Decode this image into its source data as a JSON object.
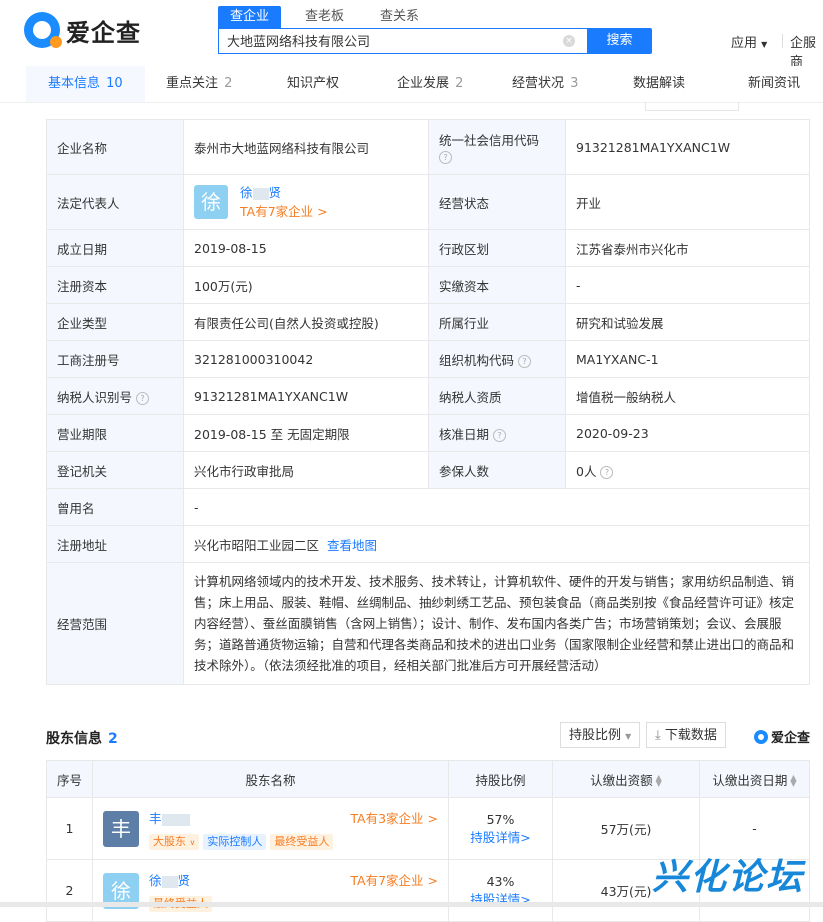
{
  "logo": {
    "text": "爱企查"
  },
  "search": {
    "tabs": [
      "查企业",
      "查老板",
      "查关系"
    ],
    "value": "大地蓝网络科技有限公司",
    "button": "搜索"
  },
  "header_links": {
    "apps": "应用",
    "service": "企服商"
  },
  "tabs": [
    {
      "label": "基本信息",
      "count": "10"
    },
    {
      "label": "重点关注",
      "count": "2"
    },
    {
      "label": "知识产权",
      "count": ""
    },
    {
      "label": "企业发展",
      "count": "2"
    },
    {
      "label": "经营状况",
      "count": "3"
    },
    {
      "label": "数据解读",
      "count": ""
    },
    {
      "label": "新闻资讯",
      "count": ""
    }
  ],
  "info": {
    "company_name_label": "企业名称",
    "company_name": "泰州市大地蓝网络科技有限公司",
    "credit_code_label": "统一社会信用代码",
    "credit_code": "91321281MA1YXANC1W",
    "legal_rep_label": "法定代表人",
    "legal_rep_avatar": "徐",
    "legal_rep_name_a": "徐",
    "legal_rep_name_b": "贤",
    "legal_rep_link": "TA有7家企业 >",
    "status_label": "经营状态",
    "status": "开业",
    "founded_label": "成立日期",
    "founded": "2019-08-15",
    "region_label": "行政区划",
    "region": "江苏省泰州市兴化市",
    "capital_label": "注册资本",
    "capital": "100万(元)",
    "paid_label": "实缴资本",
    "paid": "-",
    "type_label": "企业类型",
    "type": "有限责任公司(自然人投资或控股)",
    "industry_label": "所属行业",
    "industry": "研究和试验发展",
    "reg_no_label": "工商注册号",
    "reg_no": "321281000310042",
    "org_code_label": "组织机构代码",
    "org_code": "MA1YXANC-1",
    "tax_id_label": "纳税人识别号",
    "tax_id": "91321281MA1YXANC1W",
    "taxpayer_label": "纳税人资质",
    "taxpayer": "增值税一般纳税人",
    "term_label": "营业期限",
    "term": "2019-08-15 至 无固定期限",
    "approve_label": "核准日期",
    "approve": "2020-09-23",
    "authority_label": "登记机关",
    "authority": "兴化市行政审批局",
    "insured_label": "参保人数",
    "insured": "0人",
    "former_label": "曾用名",
    "former": "-",
    "address_label": "注册地址",
    "address": "兴化市昭阳工业园二区",
    "map_link": "查看地图",
    "scope_label": "经营范围",
    "scope": "计算机网络领域内的技术开发、技术服务、技术转让，计算机软件、硬件的开发与销售；家用纺织品制造、销售；床上用品、服装、鞋帽、丝绸制品、抽纱刺绣工艺品、预包装食品（商品类别按《食品经营许可证》核定内容经营）、蚕丝面膜销售（含网上销售）；设计、制作、发布国内各类广告；市场营销策划；会议、会展服务；道路普通货物运输；自营和代理各类商品和技术的进出口业务（国家限制企业经营和禁止进出口的商品和技术除外）。（依法须经批准的项目，经相关部门批准后方可开展经营活动）"
  },
  "shareholders": {
    "title": "股东信息",
    "count": "2",
    "ratio_btn": "持股比例",
    "download_btn": "下载数据",
    "brand": "爱企查",
    "headers": [
      "序号",
      "股东名称",
      "持股比例",
      "认缴出资额",
      "认缴出资日期"
    ],
    "rows": [
      {
        "index": "1",
        "avatar": "丰",
        "name": "丰",
        "link": "TA有3家企业 >",
        "tags": [
          "大股东",
          "实际控制人",
          "最终受益人"
        ],
        "ratio": "57%",
        "detail": "持股详情",
        "amount": "57万(元)",
        "date": "-"
      },
      {
        "index": "2",
        "avatar": "徐",
        "name_a": "徐",
        "name_b": "贤",
        "link": "TA有7家企业 >",
        "tags": [
          "最终受益人"
        ],
        "ratio": "43%",
        "detail": "持股详情",
        "amount": "43万(元)",
        "date": ""
      }
    ]
  },
  "watermark": "兴化论坛",
  "colors": {
    "accent": "#1a7bff",
    "orange": "#f77d22",
    "label_bg": "#f4f8fe"
  }
}
